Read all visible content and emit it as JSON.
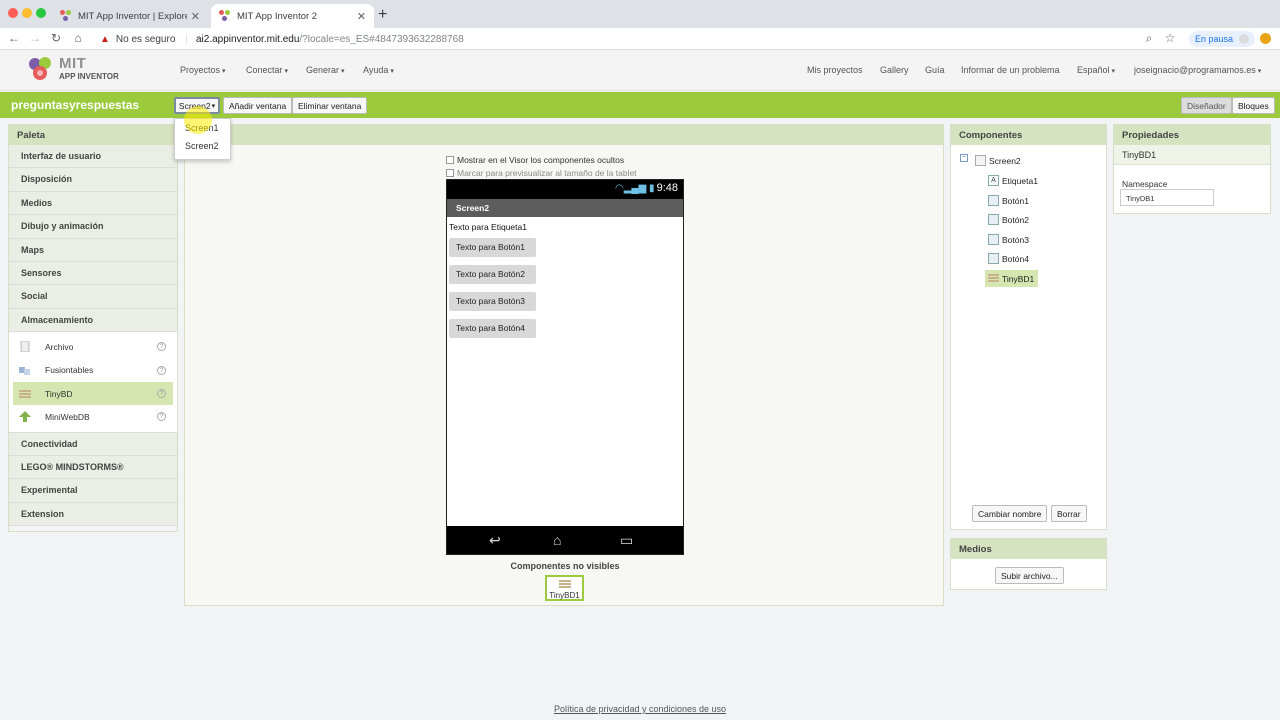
{
  "browser": {
    "tabs": [
      {
        "title": "MIT App Inventor | Explore MIT"
      },
      {
        "title": "MIT App Inventor 2"
      }
    ],
    "new_tab": "+",
    "security_label": "No es seguro",
    "url_main": "ai2.appinventor.mit.edu",
    "url_rest": "/?locale=es_ES#4847393632288768",
    "profile_status": "En pausa"
  },
  "header": {
    "logo_title": "MIT",
    "logo_sub": "APP INVENTOR",
    "menus": [
      "Proyectos",
      "Conectar",
      "Generar",
      "Ayuda"
    ],
    "links": [
      "Mis proyectos",
      "Gallery",
      "Guía",
      "Informar de un problema"
    ],
    "language": "Español",
    "user": "joseignacio@programamos.es"
  },
  "toolbar": {
    "project_name": "preguntasyrespuestas",
    "screen_select": "Screen2",
    "add_screen": "Añadir ventana",
    "remove_screen": "Eliminar ventana",
    "designer": "Diseñador",
    "blocks": "Bloques"
  },
  "screen_dropdown": [
    "Screen1",
    "Screen2"
  ],
  "palette": {
    "title": "Paleta",
    "categories_top": [
      "Interfaz de usuario",
      "Disposición",
      "Medios",
      "Dibujo y animación",
      "Maps",
      "Sensores",
      "Social",
      "Almacenamiento"
    ],
    "storage_items": [
      {
        "label": "Archivo",
        "icon": "file-icon"
      },
      {
        "label": "Fusiontables",
        "icon": "fusiontables-icon"
      },
      {
        "label": "TinyBD",
        "icon": "database-icon"
      },
      {
        "label": "MiniWebDB",
        "icon": "webdb-icon"
      }
    ],
    "help": "?",
    "categories_bottom": [
      "Conectividad",
      "LEGO® MINDSTORMS®",
      "Experimental",
      "Extension"
    ]
  },
  "viewer": {
    "show_hidden": "Mostrar en el Visor los componentes ocultos",
    "tablet_preview": "Marcar para previsualizar al tamaño de la tablet",
    "phone_time": "9:48",
    "screen_title": "Screen2",
    "label_text": "Texto para Etiqueta1",
    "buttons": [
      "Texto para Botón1",
      "Texto para Botón2",
      "Texto para Botón3",
      "Texto para Botón4"
    ],
    "nonvisible_title": "Componentes no visibles",
    "nonvisible_item": "TinyBD1"
  },
  "components": {
    "title": "Componentes",
    "root": "Screen2",
    "children": [
      "Etiqueta1",
      "Botón1",
      "Botón2",
      "Botón3",
      "Botón4",
      "TinyBD1"
    ],
    "rename": "Cambiar nombre",
    "delete": "Borrar"
  },
  "media": {
    "title": "Medios",
    "upload": "Subir archivo..."
  },
  "properties": {
    "title": "Propiedades",
    "component": "TinyBD1",
    "namespace_label": "Namespace",
    "namespace_value": "TinyDB1"
  },
  "footer": {
    "privacy": "Política de privacidad y condiciones de uso"
  },
  "colors": {
    "accent_green": "#9bcb3c",
    "panel_header": "#d6e3c0",
    "highlight": "#d6e6b0"
  }
}
